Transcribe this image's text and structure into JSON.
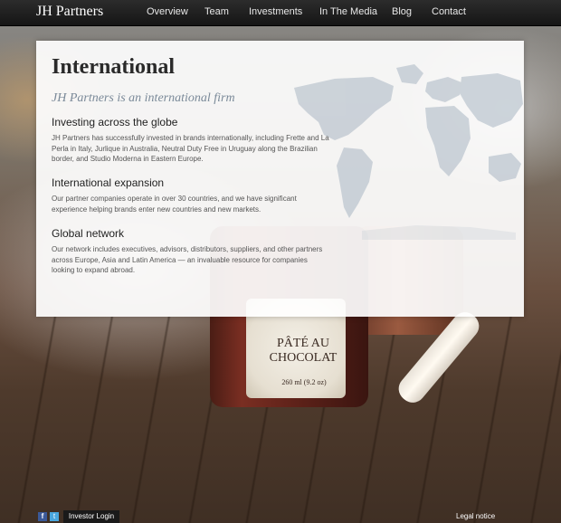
{
  "header": {
    "logo": "JH Partners",
    "nav": [
      {
        "label": "Overview"
      },
      {
        "label": "Team"
      },
      {
        "label": "Investments"
      },
      {
        "label": "In The Media"
      },
      {
        "label": "Blog"
      },
      {
        "label": "Contact"
      }
    ]
  },
  "main": {
    "title": "International",
    "subtitle": "JH Partners is an international firm",
    "sections": [
      {
        "heading": "Investing across the globe",
        "body": "JH Partners has successfully invested in brands internationally, including Frette and La Perla in Italy, Jurlique in Australia, Neutral Duty Free in Uruguay along the Brazilian border, and Studio Moderna in Eastern Europe."
      },
      {
        "heading": "International expansion",
        "body": "Our partner companies operate in over 30 countries, and we have significant experience helping brands enter new countries and new markets."
      },
      {
        "heading": "Global network",
        "body": "Our network includes executives, advisors, distributors, suppliers, and other partners across Europe, Asia and Latin America — an invaluable resource for companies looking to expand abroad."
      }
    ]
  },
  "background": {
    "jar_title": "PÂTÉ AU CHOCOLAT",
    "jar_volume": "260 ml (9.2 oz)"
  },
  "footer": {
    "facebook": "f",
    "twitter": "t",
    "investor_login": "Investor Login",
    "legal": "Legal notice"
  },
  "colors": {
    "nav_bg": "#1e1e1e",
    "subtitle": "#7b8a99",
    "map": "#9aa9b8"
  }
}
